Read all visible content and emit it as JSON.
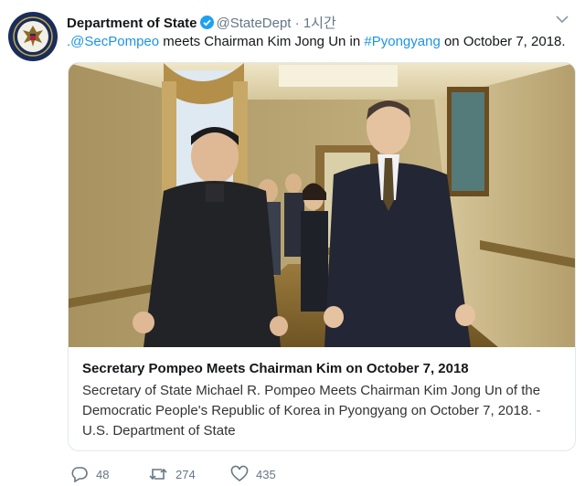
{
  "tweet": {
    "author_name": "Department of State",
    "author_handle": "@StateDept",
    "separator": "·",
    "time_ago": "1시간",
    "text_link_mention": ".@SecPompeo",
    "text_middle": " meets Chairman Kim Jong Un in ",
    "text_link_hashtag": "#Pyongyang",
    "text_end": " on October 7, 2018."
  },
  "card": {
    "title": "Secretary Pompeo Meets Chairman Kim on October 7, 2018",
    "description_line1": "Secretary of State Michael R. Pompeo Meets Chairman Kim Jong Un of the",
    "description_line2": "Democratic People's Republic of Korea in Pyongyang on October 7, 2018. -",
    "description_line3": "U.S. Department of State"
  },
  "actions": {
    "reply_count": "48",
    "retweet_count": "274",
    "like_count": "435"
  },
  "colors": {
    "link": "#1b95e0",
    "muted": "#657786",
    "verified": "#1da1f2",
    "avatar_bg": "#1a2d5a"
  },
  "icons": [
    "state-seal-icon",
    "verified-badge-icon",
    "chevron-down-icon",
    "reply-icon",
    "retweet-icon",
    "like-icon"
  ]
}
